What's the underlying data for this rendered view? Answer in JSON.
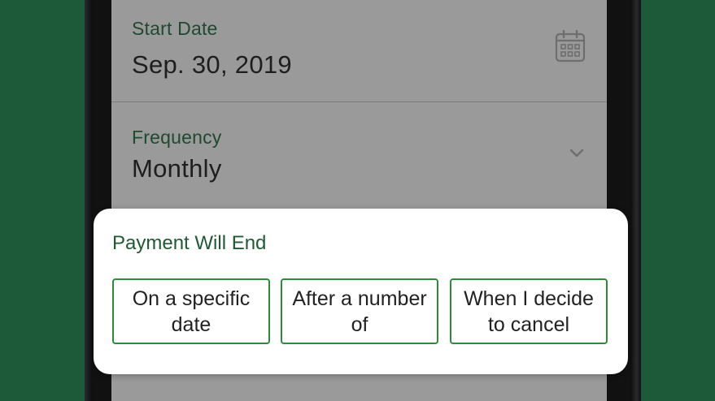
{
  "form": {
    "start_date": {
      "label": "Start Date",
      "value": "Sep. 30, 2019",
      "icon": "calendar-icon"
    },
    "frequency": {
      "label": "Frequency",
      "value": "Monthly",
      "icon": "chevron-down-icon"
    }
  },
  "dialog": {
    "title": "Payment Will End",
    "options": [
      {
        "label": "On a specific date"
      },
      {
        "label": "After a number of"
      },
      {
        "label": "When I decide to cancel"
      }
    ]
  },
  "colors": {
    "background": "#1d5a3a",
    "accent_green": "#2e8b3a",
    "label_green": "#1f4a30",
    "overlay_gray": "#9a9a9a"
  }
}
